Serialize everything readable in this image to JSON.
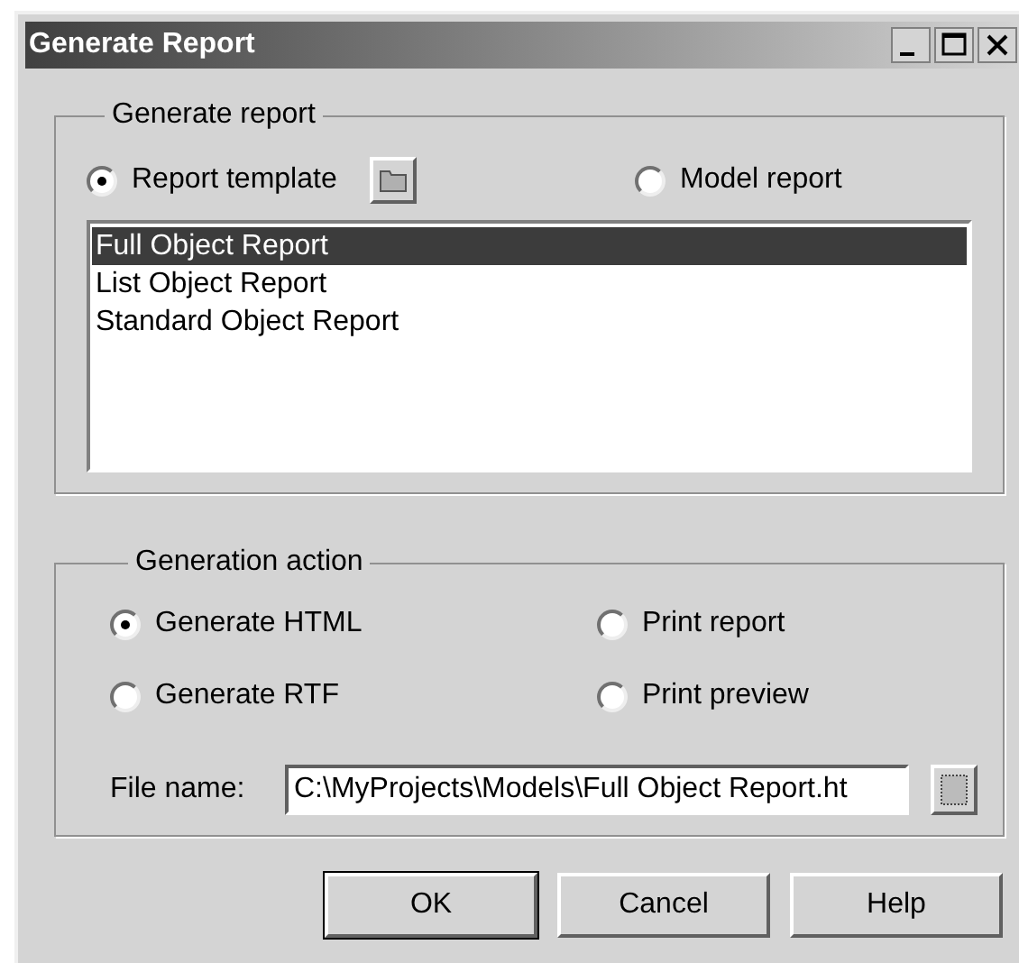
{
  "window": {
    "title": "Generate Report"
  },
  "generate_report": {
    "label": "Generate report",
    "options": [
      {
        "label": "Report template",
        "selected": true
      },
      {
        "label": "Model report",
        "selected": false
      }
    ],
    "templates": [
      {
        "label": "Full Object Report",
        "selected": true
      },
      {
        "label": "List Object Report",
        "selected": false
      },
      {
        "label": "Standard Object Report",
        "selected": false
      }
    ]
  },
  "generation_action": {
    "label": "Generation action",
    "options": [
      {
        "label": "Generate HTML",
        "selected": true
      },
      {
        "label": "Print report",
        "selected": false
      },
      {
        "label": "Generate RTF",
        "selected": false
      },
      {
        "label": "Print preview",
        "selected": false
      }
    ],
    "file_name": {
      "label": "File name:",
      "value": "C:\\MyProjects\\Models\\Full Object Report.ht"
    }
  },
  "buttons": [
    {
      "label": "OK",
      "default": true
    },
    {
      "label": "Cancel",
      "default": false
    },
    {
      "label": "Help",
      "default": false
    }
  ]
}
